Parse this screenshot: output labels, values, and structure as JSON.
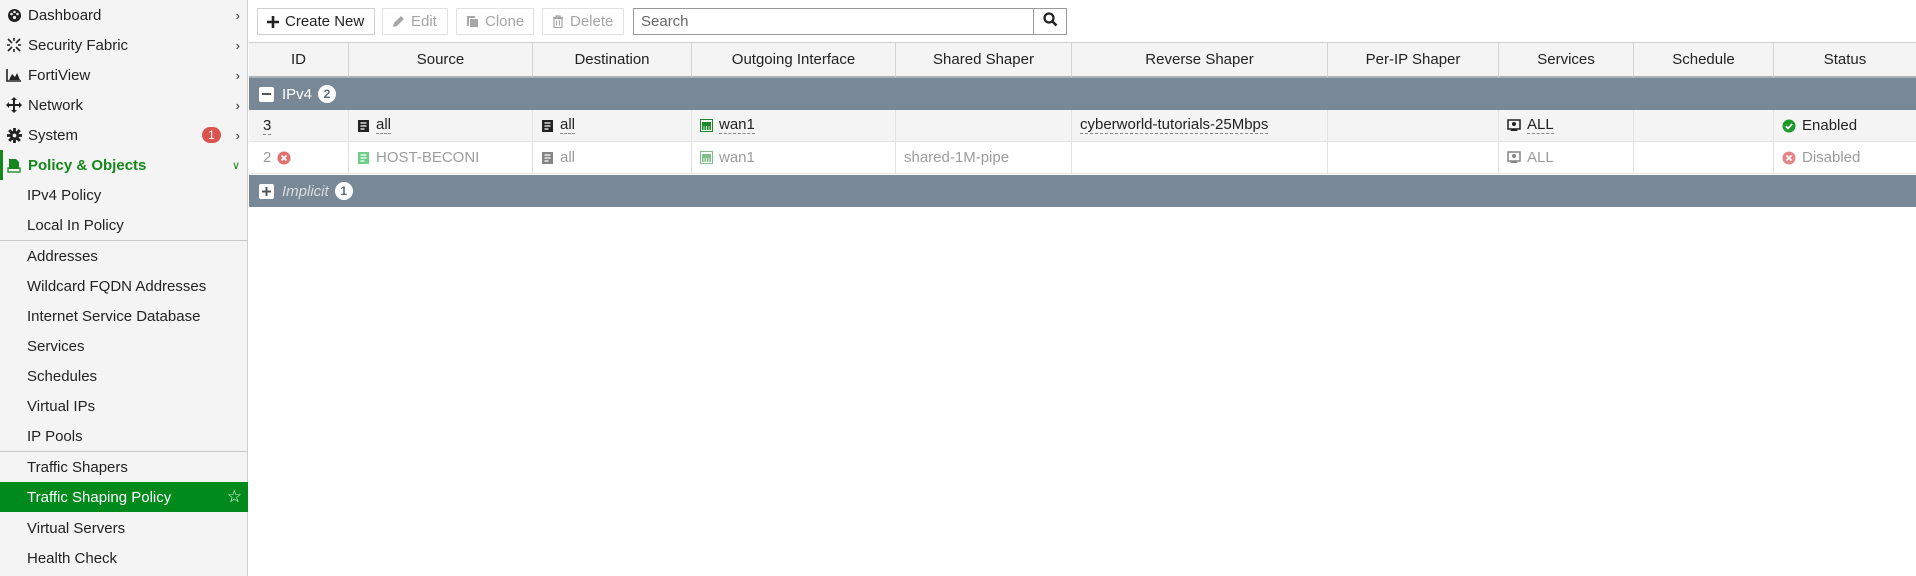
{
  "sidebar": {
    "main_items": [
      {
        "label": "Dashboard",
        "icon": "dashboard-icon"
      },
      {
        "label": "Security Fabric",
        "icon": "security-fabric-icon"
      },
      {
        "label": "FortiView",
        "icon": "fortiview-icon"
      },
      {
        "label": "Network",
        "icon": "network-icon"
      },
      {
        "label": "System",
        "icon": "gear-icon",
        "badge": "1"
      },
      {
        "label": "Policy & Objects",
        "icon": "policy-icon",
        "expanded": true
      }
    ],
    "sub_items": [
      {
        "label": "IPv4 Policy"
      },
      {
        "label": "Local In Policy"
      },
      {
        "label": "Addresses"
      },
      {
        "label": "Wildcard FQDN Addresses"
      },
      {
        "label": "Internet Service Database"
      },
      {
        "label": "Services"
      },
      {
        "label": "Schedules"
      },
      {
        "label": "Virtual IPs"
      },
      {
        "label": "IP Pools"
      },
      {
        "label": "Traffic Shapers"
      },
      {
        "label": "Traffic Shaping Policy",
        "selected": true
      },
      {
        "label": "Virtual Servers"
      },
      {
        "label": "Health Check"
      }
    ]
  },
  "toolbar": {
    "create_new": "Create New",
    "edit": "Edit",
    "clone": "Clone",
    "delete": "Delete",
    "search_placeholder": "Search"
  },
  "table": {
    "columns": [
      "ID",
      "Source",
      "Destination",
      "Outgoing Interface",
      "Shared Shaper",
      "Reverse Shaper",
      "Per-IP Shaper",
      "Services",
      "Schedule",
      "Status"
    ],
    "groups": [
      {
        "label": "IPv4",
        "count": "2",
        "expanded": true
      },
      {
        "label": "Implicit",
        "count": "1",
        "expanded": false
      }
    ],
    "rows": [
      {
        "id": "3",
        "source": "all",
        "destination": "all",
        "outgoing_interface": "wan1",
        "shared_shaper": "",
        "reverse_shaper": "cyberworld-tutorials-25Mbps",
        "per_ip_shaper": "",
        "services": "ALL",
        "schedule": "",
        "status": "Enabled",
        "enabled": true
      },
      {
        "id": "2",
        "source": "HOST-BECONI",
        "destination": "all",
        "outgoing_interface": "wan1",
        "shared_shaper": "shared-1M-pipe",
        "reverse_shaper": "",
        "per_ip_shaper": "",
        "services": "ALL",
        "schedule": "",
        "status": "Disabled",
        "enabled": false
      }
    ]
  },
  "colors": {
    "accent_green": "#008a1c",
    "group_header": "#788896",
    "enabled": "#1a9a2a",
    "disabled": "#e07070",
    "badge_red": "#d9534f"
  }
}
